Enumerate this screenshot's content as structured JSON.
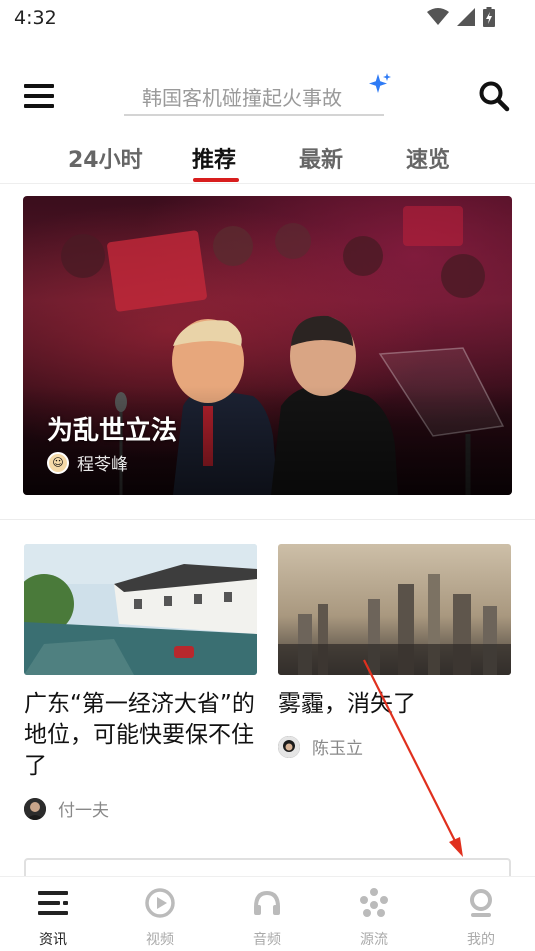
{
  "status_bar": {
    "time": "4:32"
  },
  "search": {
    "placeholder": "韩国客机碰撞起火事故"
  },
  "tabs": [
    {
      "label": "24小时",
      "active": false
    },
    {
      "label": "推荐",
      "active": true
    },
    {
      "label": "最新",
      "active": false
    },
    {
      "label": "速览",
      "active": false
    }
  ],
  "hero": {
    "title": "为乱世立法",
    "author": "程苓峰"
  },
  "articles": [
    {
      "title": "广东“第一经济大省”的地位，可能快要保不住了",
      "author": "付一夫"
    },
    {
      "title": "雾霾，消失了",
      "author": "陈玉立"
    }
  ],
  "bottom_nav": [
    {
      "label": "资讯",
      "icon": "news-icon",
      "active": true
    },
    {
      "label": "视频",
      "icon": "video-play-icon",
      "active": false
    },
    {
      "label": "音频",
      "icon": "headphones-icon",
      "active": false
    },
    {
      "label": "源流",
      "icon": "source-dots-icon",
      "active": false
    },
    {
      "label": "我的",
      "icon": "profile-icon",
      "active": false
    }
  ],
  "colors": {
    "accent": "#d81e1e",
    "sparkle": "#2f7bf5",
    "annotation_arrow": "#e0301e"
  }
}
